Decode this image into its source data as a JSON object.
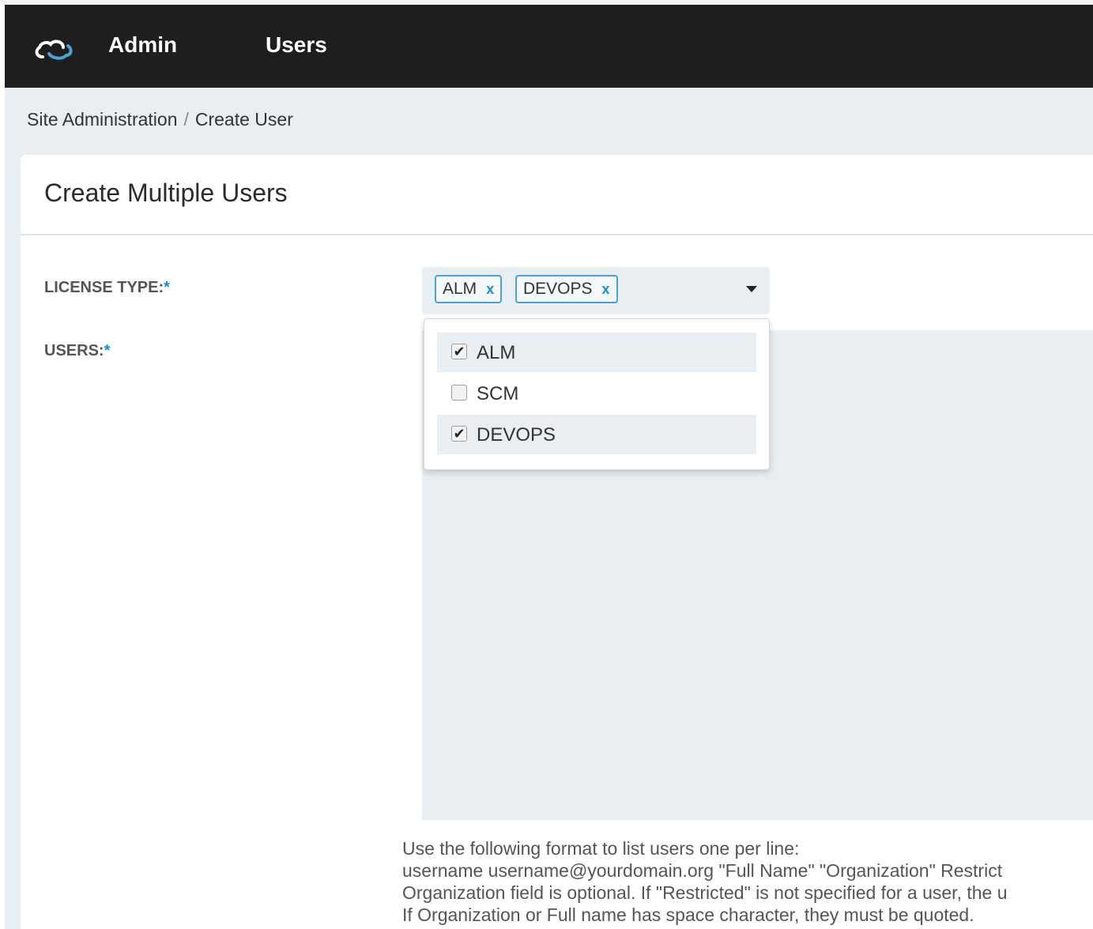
{
  "nav": {
    "brand": "Admin",
    "section": "Users"
  },
  "breadcrumb": {
    "root": "Site Administration",
    "separator": "/",
    "current": "Create User"
  },
  "card": {
    "title": "Create Multiple Users"
  },
  "form": {
    "license_label": "LICENSE TYPE:",
    "users_label": "USERS:",
    "required_mark": "*",
    "selected_chips": [
      {
        "label": "ALM",
        "remove": "x"
      },
      {
        "label": "DEVOPS",
        "remove": "x"
      }
    ],
    "options": [
      {
        "label": "ALM",
        "checked": true,
        "check_glyph": "✔"
      },
      {
        "label": "SCM",
        "checked": false,
        "check_glyph": ""
      },
      {
        "label": "DEVOPS",
        "checked": true,
        "check_glyph": "✔"
      }
    ]
  },
  "help": {
    "lines": [
      "Use the following format to list users one per line:",
      "username username@yourdomain.org \"Full Name\" \"Organization\" Restrict",
      "Organization field is optional. If \"Restricted\" is not specified for a user, the u",
      "If Organization or Full name has space character, they must be quoted."
    ]
  },
  "colors": {
    "navbar": "#1e1e1e",
    "accent": "#1a8fc9",
    "page_bg": "#e8eef1"
  },
  "icons": {
    "logo": "cloud-logo-icon",
    "caret": "caret-down-icon",
    "check": "checkmark-icon"
  }
}
